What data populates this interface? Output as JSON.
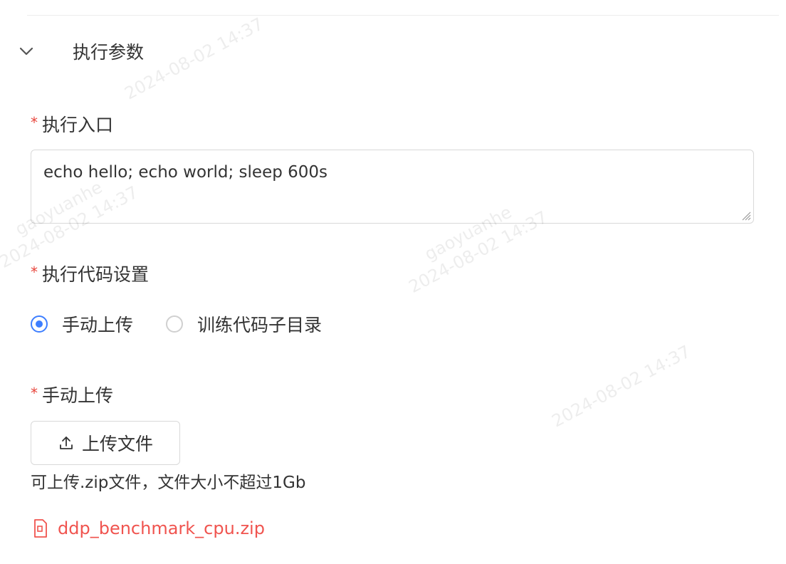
{
  "section": {
    "title": "执行参数",
    "chevron_icon": "chevron-down-icon"
  },
  "entry": {
    "required_mark": "*",
    "label": "执行入口",
    "value": "echo hello; echo world; sleep 600s"
  },
  "code_settings": {
    "required_mark": "*",
    "label": "执行代码设置",
    "options": [
      {
        "label": "手动上传",
        "checked": true
      },
      {
        "label": "训练代码子目录",
        "checked": false
      }
    ]
  },
  "manual_upload": {
    "required_mark": "*",
    "label": "手动上传",
    "button_label": "上传文件",
    "button_icon": "upload-icon",
    "hint": "可上传.zip文件，文件大小不超过1Gb",
    "file": {
      "name": "ddp_benchmark_cpu.zip",
      "icon": "file-icon",
      "color": "#f0544f"
    }
  },
  "watermark": {
    "user": "gaoyuanhe",
    "timestamp": "2024-08-02 14:37"
  },
  "colors": {
    "accent": "#3d7eff",
    "required": "#e8453c",
    "error_file": "#f0544f"
  }
}
